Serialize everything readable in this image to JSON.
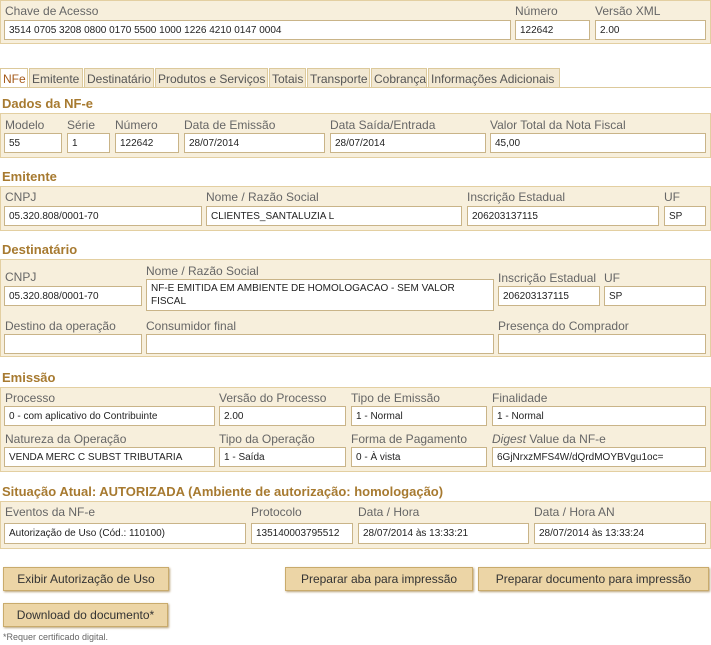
{
  "header": {
    "chave_label": "Chave de Acesso",
    "chave_value": "3514 0705 3208 0800 0170 5500 1000 1226 4210 0147 0004",
    "numero_label": "Número",
    "numero_value": "122642",
    "versao_label": "Versão XML",
    "versao_value": "2.00"
  },
  "tabs": [
    "NFe",
    "Emitente",
    "Destinatário",
    "Produtos e Serviços",
    "Totais",
    "Transporte",
    "Cobrança",
    "Informações Adicionais"
  ],
  "dados": {
    "title": "Dados da NF-e",
    "modelo_label": "Modelo",
    "modelo_value": "55",
    "serie_label": "Série",
    "serie_value": "1",
    "numero_label": "Número",
    "numero_value": "122642",
    "emissao_label": "Data de Emissão",
    "emissao_value": "28/07/2014",
    "saida_label": "Data Saída/Entrada",
    "saida_value": "28/07/2014",
    "valor_label": "Valor Total da Nota Fiscal",
    "valor_value": "45,00"
  },
  "emitente": {
    "title": "Emitente",
    "cnpj_label": "CNPJ",
    "cnpj_value": "05.320.808/0001-70",
    "nome_label": "Nome / Razão Social",
    "nome_value": "CLIENTES_SANTALUZIA L",
    "ie_label": "Inscrição Estadual",
    "ie_value": "206203137115",
    "uf_label": "UF",
    "uf_value": "SP"
  },
  "destinatario": {
    "title": "Destinatário",
    "cnpj_label": "CNPJ",
    "cnpj_value": "05.320.808/0001-70",
    "nome_label": "Nome / Razão Social",
    "nome_value": "NF-E EMITIDA EM AMBIENTE DE HOMOLOGACAO - SEM VALOR FISCAL",
    "ie_label": "Inscrição Estadual",
    "ie_value": "206203137115",
    "uf_label": "UF",
    "uf_value": "SP",
    "destino_label": "Destino da operação",
    "destino_value": "",
    "consumidor_label": "Consumidor final",
    "consumidor_value": "",
    "presenca_label": "Presença do Comprador",
    "presenca_value": ""
  },
  "emissao": {
    "title": "Emissão",
    "processo_label": "Processo",
    "processo_value": "0 - com aplicativo do Contribuinte",
    "versao_label": "Versão do Processo",
    "versao_value": "2.00",
    "tipo_label": "Tipo de Emissão",
    "tipo_value": "1 - Normal",
    "finalidade_label": "Finalidade",
    "finalidade_value": "1 - Normal",
    "natureza_label": "Natureza da Operação",
    "natureza_value": "VENDA MERC C SUBST TRIBUTARIA",
    "tipo_op_label": "Tipo da Operação",
    "tipo_op_value": "1 - Saída",
    "pagamento_label": "Forma de Pagamento",
    "pagamento_value": "0 - À vista",
    "digest_label_italic": "Digest",
    "digest_label_rest": " Value da NF-e",
    "digest_value": "6GjNrxzMFS4W/dQrdMOYBVgu1oc="
  },
  "situacao": {
    "title": "Situação Atual:  AUTORIZADA (Ambiente de autorização: homologação)",
    "eventos_label": "Eventos da NF-e",
    "eventos_value": "Autorização de Uso (Cód.: 110100)",
    "protocolo_label": "Protocolo",
    "protocolo_value": "135140003795512",
    "datahora_label": "Data / Hora",
    "datahora_value": "28/07/2014 às 13:33:21",
    "datahora_an_label": "Data / Hora AN",
    "datahora_an_value": "28/07/2014 às 13:33:24"
  },
  "buttons": {
    "exibir": "Exibir Autorização de Uso",
    "preparar_aba": "Preparar aba para impressão",
    "preparar_doc": "Preparar documento para impressão",
    "download": "Download do documento*"
  },
  "footnote": "*Requer certificado digital."
}
